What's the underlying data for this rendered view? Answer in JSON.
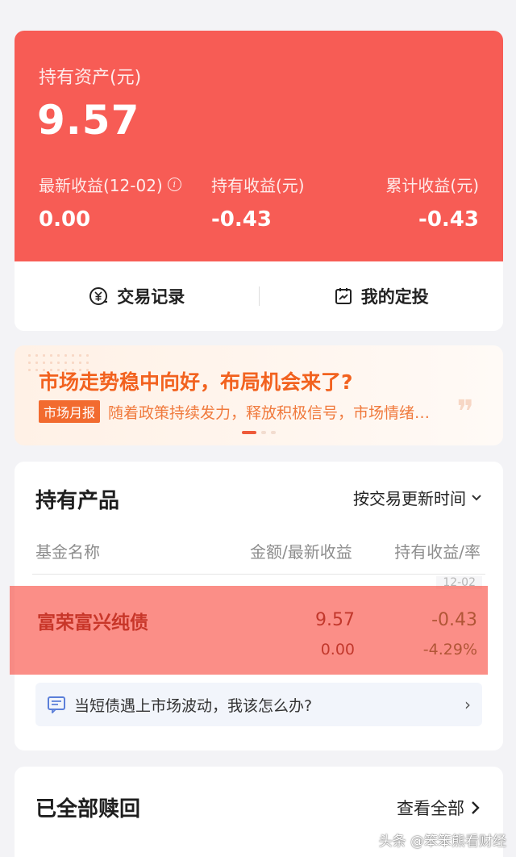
{
  "assets": {
    "label": "持有资产(元)",
    "value": "9.57",
    "stats": {
      "latest_label": "最新收益(12-02)",
      "latest_value": "0.00",
      "hold_label": "持有收益(元)",
      "hold_value": "-0.43",
      "cumulative_label": "累计收益(元)",
      "cumulative_value": "-0.43"
    },
    "info_icon": "i",
    "actions": {
      "trade_records": "交易记录",
      "my_plans": "我的定投"
    }
  },
  "banner": {
    "title": "市场走势稳中向好，布局机会来了?",
    "tag": "市场月报",
    "text": "随着政策持续发力，释放积极信号，市场情绪…",
    "quote_mark": "❞"
  },
  "holdings": {
    "title": "持有产品",
    "sort_label": "按交易更新时间",
    "columns": {
      "name": "基金名称",
      "amount": "金额/最新收益",
      "hold": "持有收益/率"
    },
    "date_tag": "12-02",
    "fund": {
      "name": "富荣富兴纯债",
      "amount": "9.57",
      "latest": "0.00",
      "hold": "-0.43",
      "rate": "-4.29%"
    },
    "tip": "当短债遇上市场波动，我该怎么办?",
    "tip_chevron": "›"
  },
  "redeemed": {
    "title": "已全部赎回",
    "view_all": "查看全部"
  },
  "watermark": "头条 @笨笨熊看财经",
  "colors": {
    "primary_red": "#f75c55",
    "banner_orange": "#f2621f",
    "loss_green": "#3e6b2c"
  }
}
